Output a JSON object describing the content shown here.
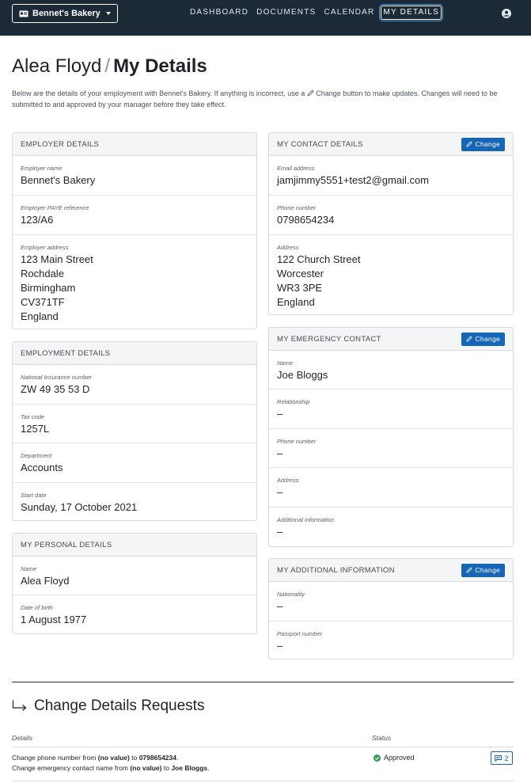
{
  "nav": {
    "company": "Bennet's Bakery",
    "links": [
      "DASHBOARD",
      "DOCUMENTS",
      "CALENDAR",
      "MY DETAILS"
    ],
    "active": "MY DETAILS"
  },
  "page": {
    "title_name": "Alea Floyd",
    "title_separator": "/",
    "title_section": "My Details",
    "intro_before": "Below are the details of your employment with Bennet's Bakery. If anything is incorrect, use a",
    "intro_after": "Change button to make updates. Changes will need to be submitted to and approved by your manager before they take effect."
  },
  "employer": {
    "header": "EMPLOYER DETAILS",
    "fields": [
      {
        "label": "Employer name",
        "value": "Bennet's Bakery"
      },
      {
        "label": "Employer PAYE reference",
        "value": "123/A6"
      },
      {
        "label": "Employer address",
        "value": "123 Main Street\nRochdale\nBirmingham\nCV371TF\nEngland"
      }
    ]
  },
  "employment": {
    "header": "EMPLOYMENT DETAILS",
    "fields": [
      {
        "label": "National Insurance number",
        "value": "ZW 49 35 53 D"
      },
      {
        "label": "Tax code",
        "value": "1257L"
      },
      {
        "label": "Department",
        "value": "Accounts"
      },
      {
        "label": "Start date",
        "value": "Sunday, 17 October 2021"
      }
    ]
  },
  "personal": {
    "header": "MY PERSONAL DETAILS",
    "fields": [
      {
        "label": "Name",
        "value": "Alea Floyd"
      },
      {
        "label": "Date of birth",
        "value": "1 August 1977"
      }
    ]
  },
  "contact": {
    "header": "MY CONTACT DETAILS",
    "change_label": "Change",
    "fields": [
      {
        "label": "Email address",
        "value": "jamjimmy5551+test2@gmail.com"
      },
      {
        "label": "Phone number",
        "value": "0798654234"
      },
      {
        "label": "Address",
        "value": "122 Church Street\nWorcester\nWR3 3PE\nEngland"
      }
    ]
  },
  "emergency": {
    "header": "MY EMERGENCY CONTACT",
    "change_label": "Change",
    "fields": [
      {
        "label": "Name",
        "value": "Joe Bloggs"
      },
      {
        "label": "Relationship",
        "value": "–"
      },
      {
        "label": "Phone number",
        "value": "–"
      },
      {
        "label": "Address",
        "value": "–"
      },
      {
        "label": "Additional information",
        "value": "–"
      }
    ]
  },
  "additional": {
    "header": "MY ADDITIONAL INFORMATION",
    "change_label": "Change",
    "fields": [
      {
        "label": "Nationality",
        "value": "–"
      },
      {
        "label": "Passport number",
        "value": "–"
      }
    ]
  },
  "requests": {
    "title": "Change Details Requests",
    "col_details": "Details",
    "col_status": "Status",
    "rows": [
      {
        "line1_a": "Change phone number from",
        "line1_b": "(no value)",
        "line1_c": "to",
        "line1_d": "0798654234",
        "line1_e": ".",
        "line2_a": "Change emergency contact name from",
        "line2_b": "(no value)",
        "line2_c": "to",
        "line2_d": "Joe Bloggs",
        "line2_e": ".",
        "status": "Approved",
        "comments": "2"
      }
    ]
  },
  "colors": {
    "navbar": "#1b2a36",
    "accent": "#1666b8",
    "approved": "#2e9e4f"
  }
}
